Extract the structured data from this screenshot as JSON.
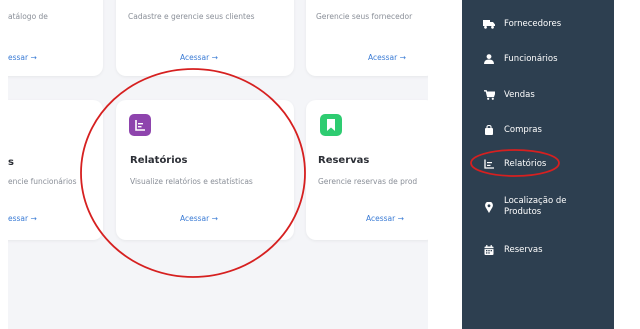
{
  "cards": {
    "top_left": {
      "desc": "atálogo de",
      "link": "essar →"
    },
    "top_mid": {
      "desc": "Cadastre e gerencie seus clientes",
      "link": "Acessar →"
    },
    "top_right": {
      "desc": "Gerencie seus fornecedor",
      "link": "Acessar →"
    },
    "mid_left": {
      "title": "s",
      "desc": "encie funcionários",
      "link": "essar →"
    },
    "relatorios": {
      "title": "Relatórios",
      "desc": "Visualize relatórios e estatísticas",
      "link": "Acessar →",
      "icon_color": "#8e44ad",
      "icon": "chart-icon"
    },
    "reservas": {
      "title": "Reservas",
      "desc": "Gerencie reservas de prod",
      "link": "Acessar →",
      "icon_color": "#2ecc71",
      "icon": "bookmark-icon"
    }
  },
  "sidebar": {
    "items": [
      {
        "label": "Fornecedores",
        "icon": "truck-icon"
      },
      {
        "label": "Funcionários",
        "icon": "user-tie-icon"
      },
      {
        "label": "Vendas",
        "icon": "cart-icon"
      },
      {
        "label": "Compras",
        "icon": "bag-icon"
      },
      {
        "label": "Relatórios",
        "icon": "report-icon"
      },
      {
        "label_line1": "Localização de",
        "label_line2": "Produtos",
        "icon": "map-marker-icon"
      },
      {
        "label": "Reservas",
        "icon": "calendar-icon"
      }
    ]
  },
  "colors": {
    "sidebar_bg": "#2d3f50",
    "link": "#3a7bd5",
    "annotation": "#d62020"
  }
}
